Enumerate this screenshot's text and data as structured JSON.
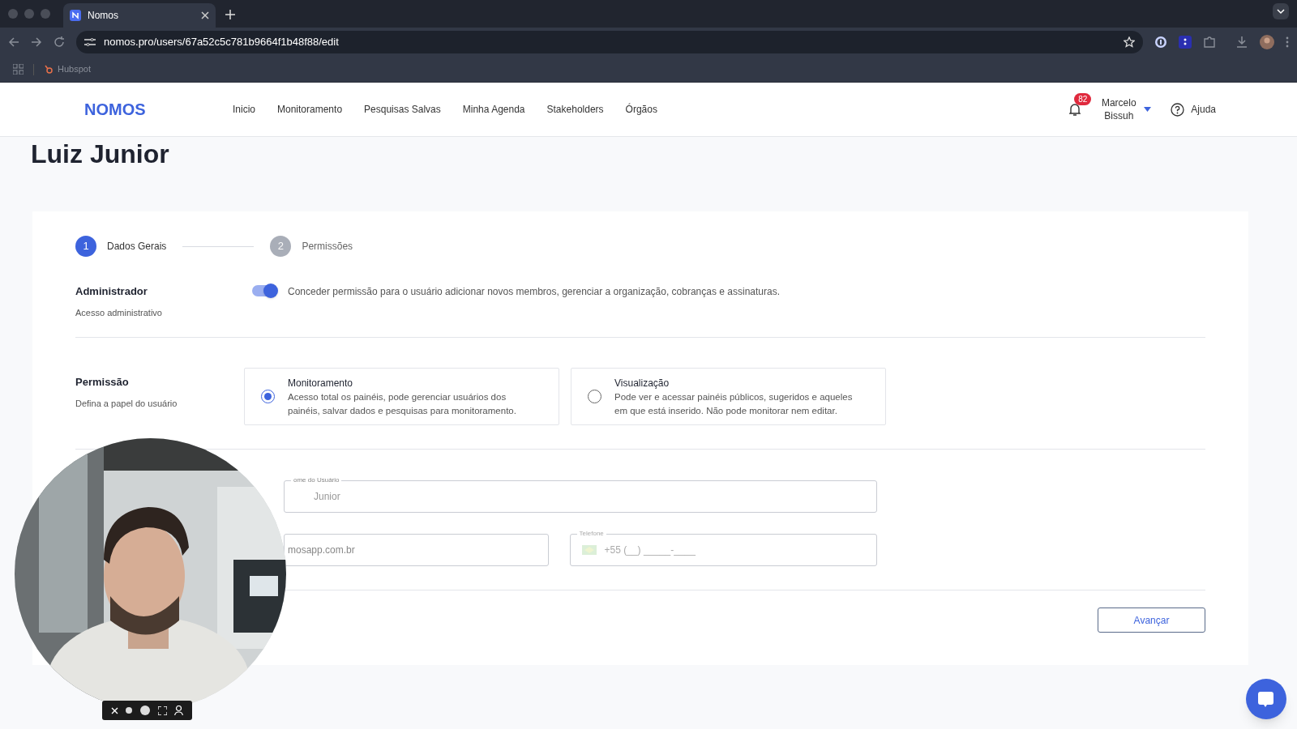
{
  "browser": {
    "tab_title": "Nomos",
    "url": "nomos.pro/users/67a52c5c781b9664f1b48f88/edit",
    "bookmark": "Hubspot"
  },
  "nav": {
    "logo": "NOMOS",
    "links": [
      "Inicio",
      "Monitoramento",
      "Pesquisas Salvas",
      "Minha Agenda",
      "Stakeholders",
      "Órgãos"
    ],
    "notification_count": "82",
    "user_name": "Marcelo Bissuh",
    "help": "Ajuda"
  },
  "page_title": "Luiz Junior",
  "stepper": [
    {
      "number": "1",
      "label": "Dados Gerais",
      "selected": true
    },
    {
      "number": "2",
      "label": "Permissões",
      "selected": false
    }
  ],
  "admin": {
    "title": "Administrador",
    "subtitle": "Acesso administrativo",
    "on": true,
    "description": "Conceder permissão para o usuário adicionar novos membros, gerenciar a organização, cobranças e assinaturas."
  },
  "permission": {
    "title": "Permissão",
    "subtitle": "Defina a papel do usuário",
    "options": [
      {
        "title": "Monitoramento",
        "description": "Acesso total os painéis, pode gerenciar usuários dos painéis, salvar dados e pesquisas para monitoramento.",
        "selected": true
      },
      {
        "title": "Visualização",
        "description": "Pode ver e acessar painéis públicos, sugeridos e aqueles em que está inserido. Não pode monitorar nem editar.",
        "selected": false
      }
    ]
  },
  "fields": {
    "name": {
      "label": "ome do Usuário",
      "value": "Junior"
    },
    "email": {
      "value": "mosapp.com.br"
    },
    "phone": {
      "label": "Telefone",
      "placeholder": "+55 (__) _____-____"
    }
  },
  "next_button": "Avançar"
}
